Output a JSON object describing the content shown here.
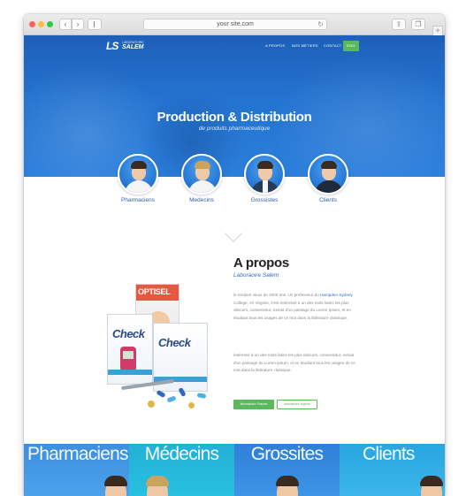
{
  "browser": {
    "address": "your site.com",
    "icons": [
      "back-icon",
      "forward-icon",
      "sidebar-icon",
      "reload-icon",
      "share-icon",
      "tabs-icon",
      "plus-icon"
    ]
  },
  "header": {
    "logo_mark": "LS",
    "logo_small": "LABORATOIRE",
    "logo_name": "SALEM",
    "nav": {
      "apropos": "A PROPOS",
      "metiers": "NOS MÉTIERS",
      "contact": "CONTACT",
      "lang": "ENG"
    }
  },
  "hero": {
    "title": "Production & Distribution",
    "subtitle": "de produits pharmaceutique"
  },
  "audiences": [
    {
      "label": "Pharmaciens"
    },
    {
      "label": "Medecins"
    },
    {
      "label": "Grossistes"
    },
    {
      "label": "Clients"
    }
  ],
  "product": {
    "box1_brand": "OPTISEL",
    "box2_brand": "Check",
    "box3_brand": "Check"
  },
  "about": {
    "title": "A propos",
    "subtitle": "Laboraoire Salem",
    "p1_before": "le rendant vieux de 2000 ans. Un professeur du ",
    "p1_link": "Hampden-Sydney",
    "p1_after": " College, en Virginie, s'est intéressé à un des mots latins les plus obscurs, consectetur, extrait d'un passage du Lorem Ipsum, et en étudiant tous les usages de ce mot dans la littérature classique.",
    "p2": "intéressé à un des mots latins les plus obscurs, consectetur, extrait d'un passage du Lorem Ipsum, et en étudiant tous les usages de ce mot dans la littérature classique.",
    "btn_primary": "laboratoire France",
    "btn_secondary": "laboratoire algerie"
  },
  "cards": [
    {
      "label": "Pharmaciens"
    },
    {
      "label": "Médecins"
    },
    {
      "label": "Grossites"
    },
    {
      "label": "Clients"
    }
  ],
  "colors": {
    "hero_blue": "#2373d0",
    "accent_green": "#5cb85c",
    "link_blue": "#2d6fc6"
  }
}
